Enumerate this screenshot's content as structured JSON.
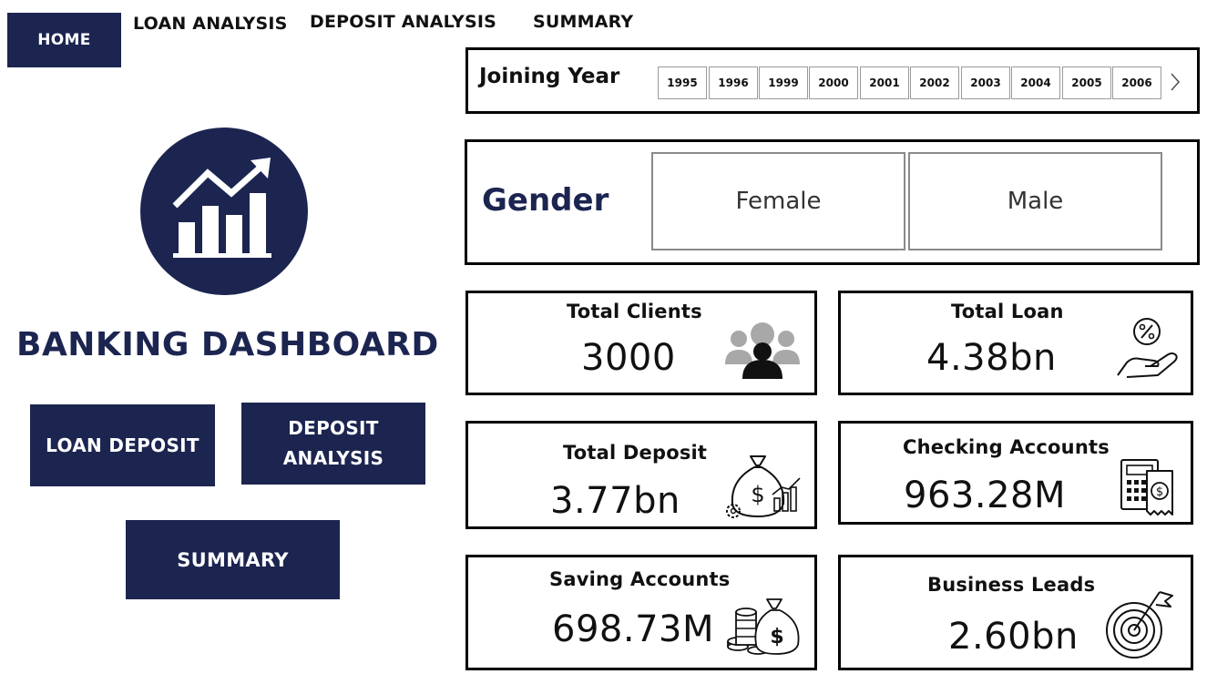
{
  "nav": {
    "home": "HOME",
    "loan_analysis": "LOAN ANALYSIS",
    "deposit_analysis": "DEPOSIT ANALYSIS",
    "summary": "SUMMARY"
  },
  "brand": {
    "title": "BANKING DASHBOARD",
    "logo_icon": "growth-chart-icon",
    "color": "#1c2550"
  },
  "side_buttons": {
    "loan_deposit": "LOAN DEPOSIT",
    "deposit_analysis": "DEPOSIT ANALYSIS",
    "summary": "SUMMARY"
  },
  "filters": {
    "joining_year": {
      "label": "Joining Year",
      "years": [
        "1995",
        "1996",
        "1999",
        "2000",
        "2001",
        "2002",
        "2003",
        "2004",
        "2005",
        "2006"
      ],
      "next_icon": "chevron-right-icon"
    },
    "gender": {
      "label": "Gender",
      "options": [
        "Female",
        "Male"
      ]
    }
  },
  "kpis": {
    "total_clients": {
      "label": "Total Clients",
      "value": "3000",
      "icon": "people-icon"
    },
    "total_loan": {
      "label": "Total Loan",
      "value": "4.38bn",
      "icon": "hand-percent-icon"
    },
    "total_deposit": {
      "label": "Total Deposit",
      "value": "3.77bn",
      "icon": "money-bag-chart-icon"
    },
    "checking_accounts": {
      "label": "Checking Accounts",
      "value": "963.28M",
      "icon": "calculator-receipt-icon"
    },
    "saving_accounts": {
      "label": "Saving Accounts",
      "value": "698.73M",
      "icon": "coins-money-bag-icon"
    },
    "business_leads": {
      "label": "Business Leads",
      "value": "2.60bn",
      "icon": "target-flag-icon"
    }
  }
}
